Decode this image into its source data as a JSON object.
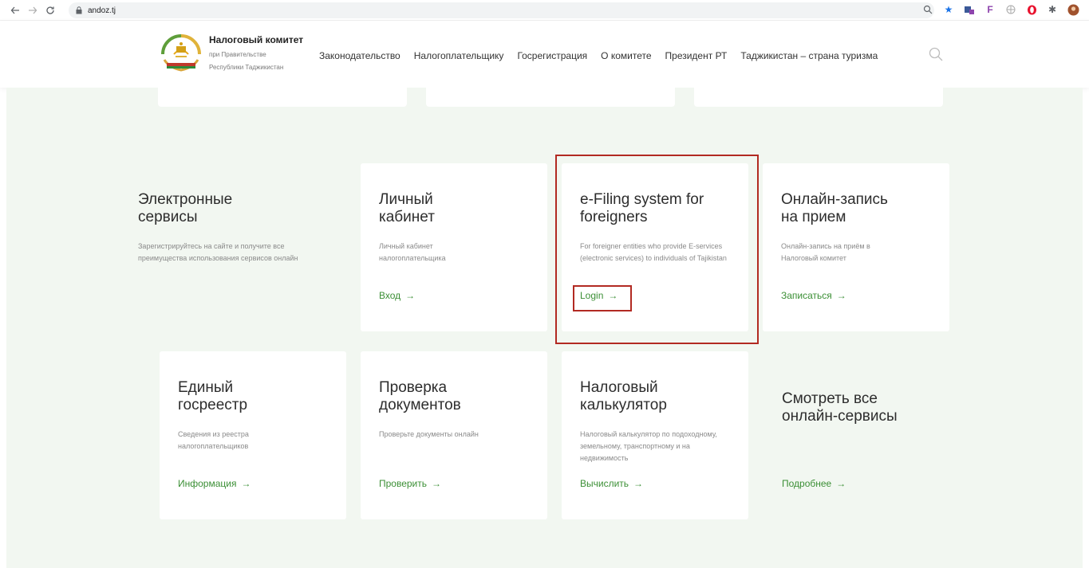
{
  "browser": {
    "url": "andoz.tj",
    "nav_icons": [
      "back-arrow-icon",
      "forward-arrow-icon",
      "reload-icon"
    ],
    "extension_icons": [
      "zoom-icon",
      "star-icon",
      "extension-icon",
      "f-extension-icon",
      "globe-icon",
      "opera-icon",
      "puzzle-icon",
      "profile-icon"
    ]
  },
  "header": {
    "org_title": "Налоговый комитет",
    "org_subtitle_1": "при Правительстве",
    "org_subtitle_2": "Республики Таджикистан",
    "nav": [
      "Законодательство",
      "Налогоплательщику",
      "Госрегистрация",
      "О комитете",
      "Президент РТ",
      "Таджикистан – страна туризма"
    ]
  },
  "colors": {
    "accent_green": "#3b8f35",
    "highlight_red": "#b22a22",
    "content_bg": "#f2f7f1"
  },
  "services": {
    "intro": {
      "title_1": "Электронные",
      "title_2": "сервисы",
      "description": "Зарегистрируйтесь на сайте и получите все преимущества использования сервисов онлайн"
    },
    "cabinet": {
      "title_1": "Личный",
      "title_2": "кабинет",
      "description": "Личный кабинет налогоплательщика",
      "link": "Вход"
    },
    "efiling": {
      "title_1": "e-Filing system for",
      "title_2": "foreigners",
      "description": "For foreigner entities who provide E-services (electronic services) to individuals of Tajikistan",
      "link": "Login"
    },
    "appointment": {
      "title_1": "Онлайн-запись",
      "title_2": "на прием",
      "description": "Онлайн-запись на приём в Налоговый комитет",
      "link": "Записаться"
    },
    "registry": {
      "title_1": "Единый",
      "title_2": "госреестр",
      "description": "Сведения из реестра налогоплательщиков",
      "link": "Информация"
    },
    "documents": {
      "title_1": "Проверка",
      "title_2": "документов",
      "description": "Проверьте документы онлайн",
      "link": "Проверить"
    },
    "calculator": {
      "title_1": "Налоговый",
      "title_2": "калькулятор",
      "description": "Налоговый калькулятор по подоходному, земельному, транспортному и на недвижимость",
      "link": "Вычислить"
    },
    "all": {
      "title_1": "Смотреть все",
      "title_2": "онлайн-сервисы",
      "link": "Подробнее"
    },
    "arrow": "→"
  }
}
